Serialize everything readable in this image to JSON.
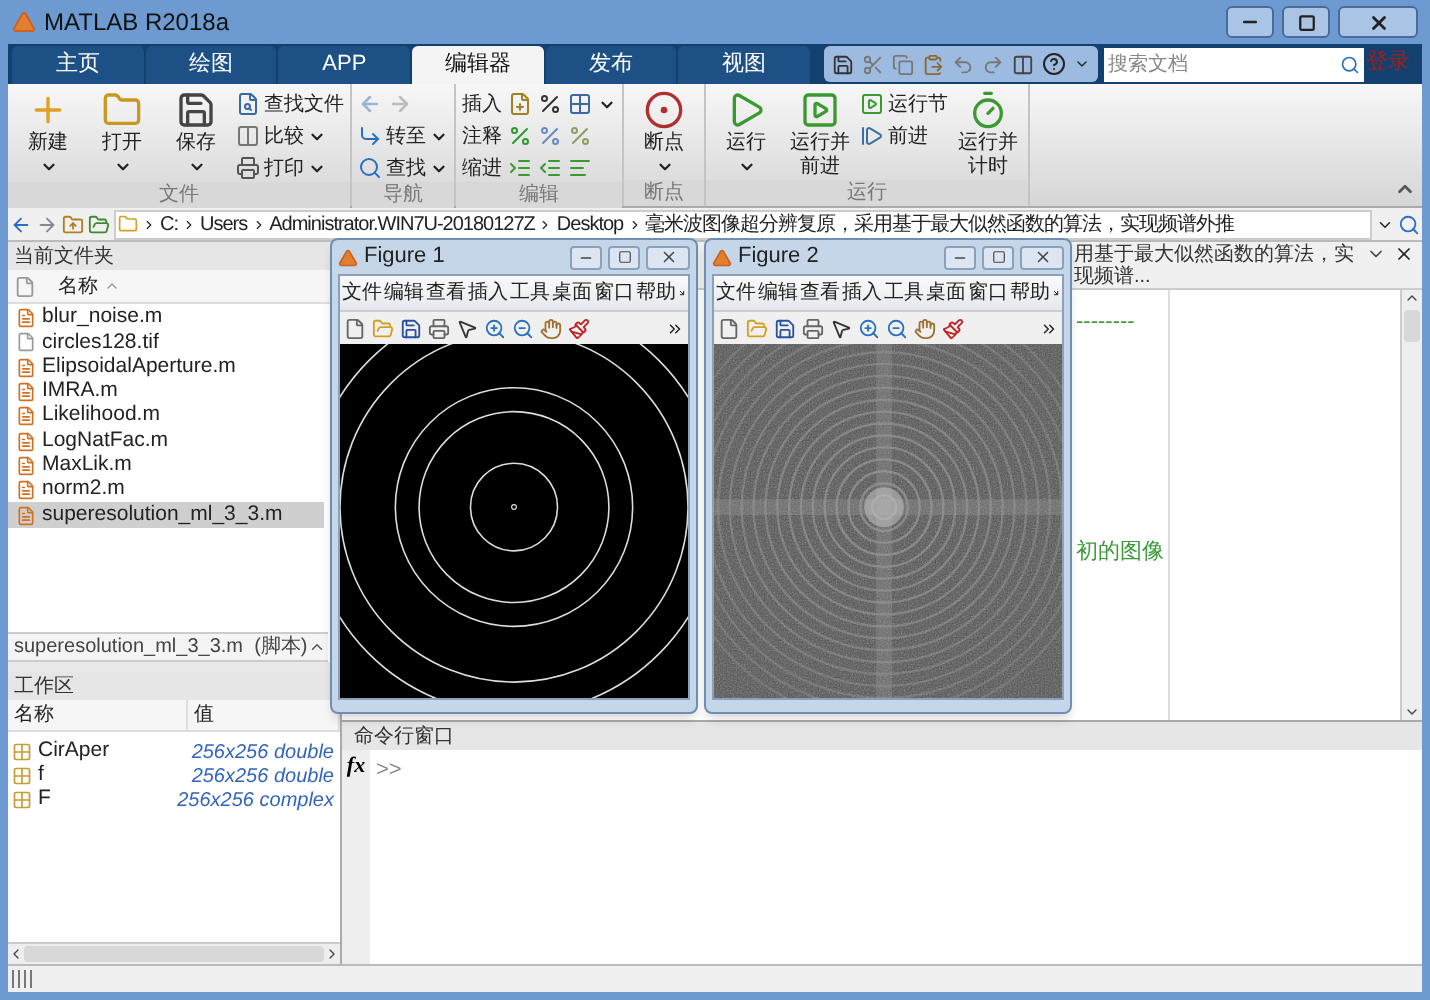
{
  "window": {
    "title": "MATLAB R2018a"
  },
  "tabs": [
    {
      "label": "主页",
      "selected": false
    },
    {
      "label": "绘图",
      "selected": false
    },
    {
      "label": "APP",
      "selected": false
    },
    {
      "label": "编辑器",
      "selected": true
    },
    {
      "label": "发布",
      "selected": false
    },
    {
      "label": "视图",
      "selected": false
    }
  ],
  "search": {
    "placeholder": "搜索文档"
  },
  "login": "登录",
  "ribbon": {
    "groups": [
      {
        "label": "文件",
        "items": [
          {
            "kind": "large",
            "label": "新建",
            "dropdown": true
          },
          {
            "kind": "large",
            "label": "打开",
            "dropdown": true
          },
          {
            "kind": "large",
            "label": "保存",
            "dropdown": true
          },
          {
            "kind": "small",
            "label": "查找文件",
            "dropdown": false
          },
          {
            "kind": "small",
            "label": "比较",
            "dropdown": true
          },
          {
            "kind": "small",
            "label": "打印",
            "dropdown": true
          }
        ]
      },
      {
        "label": "导航",
        "items": [
          {
            "kind": "nav",
            "disabled": true
          },
          {
            "kind": "small",
            "label": "转至",
            "dropdown": true
          },
          {
            "kind": "small",
            "label": "查找",
            "dropdown": true
          }
        ]
      },
      {
        "label": "编辑",
        "items": [
          {
            "kind": "edit",
            "label": "插入",
            "dropdown": true
          },
          {
            "kind": "edit",
            "label": "注释"
          },
          {
            "kind": "edit",
            "label": "缩进"
          }
        ]
      },
      {
        "label": "断点",
        "items": [
          {
            "kind": "large",
            "label": "断点",
            "dropdown": true
          }
        ]
      },
      {
        "label": "运行",
        "items": [
          {
            "kind": "large",
            "label": "运行",
            "dropdown": true
          },
          {
            "kind": "large",
            "label": "运行并前进",
            "dropdown": false
          },
          {
            "kind": "small",
            "label": "运行节",
            "dropdown": false
          },
          {
            "kind": "small",
            "label": "前进",
            "dropdown": false
          },
          {
            "kind": "large",
            "label": "运行并计时",
            "dropdown": false
          }
        ]
      }
    ]
  },
  "address": {
    "path": [
      "C:",
      "Users",
      "Administrator.WIN7U-20180127Z",
      "Desktop",
      "毫米波图像超分辨复原，采用基于最大似然函数的算法，实现频谱外推"
    ]
  },
  "current_folder": {
    "title": "当前文件夹",
    "column": "名称",
    "files": [
      {
        "name": "blur_noise.m",
        "kind": "script",
        "selected": false
      },
      {
        "name": "circles128.tif",
        "kind": "file",
        "selected": false
      },
      {
        "name": "ElipsoidalAperture.m",
        "kind": "script",
        "selected": false
      },
      {
        "name": "IMRA.m",
        "kind": "script",
        "selected": false
      },
      {
        "name": "Likelihood.m",
        "kind": "script",
        "selected": false
      },
      {
        "name": "LogNatFac.m",
        "kind": "script",
        "selected": false
      },
      {
        "name": "MaxLik.m",
        "kind": "script",
        "selected": false
      },
      {
        "name": "norm2.m",
        "kind": "script",
        "selected": false
      },
      {
        "name": "superesolution_ml_3_3.m",
        "kind": "script",
        "selected": true
      }
    ],
    "details": "superesolution_ml_3_3.m  (脚本)"
  },
  "workspace": {
    "title": "工作区",
    "columns": [
      "名称",
      "值"
    ],
    "rows": [
      {
        "name": "CirAper",
        "value": "256x256 double"
      },
      {
        "name": "f",
        "value": "256x256 double"
      },
      {
        "name": "F",
        "value": "256x256 complex"
      }
    ]
  },
  "editor": {
    "tab_title": "用基于最大似然函数的算法，实现频谱...",
    "lines": [
      {
        "text": "--------"
      },
      {
        "text": "初的图像"
      }
    ]
  },
  "command_window": {
    "title": "命令行窗口",
    "function_button": "fx",
    "prompt": ">>"
  },
  "figures": [
    {
      "title": "Figure 1",
      "menu": [
        "文件",
        "编辑",
        "查看",
        "插入",
        "工具",
        "桌面",
        "窗口",
        "帮助"
      ]
    },
    {
      "title": "Figure 2",
      "menu": [
        "文件",
        "编辑",
        "查看",
        "插入",
        "工具",
        "桌面",
        "窗口",
        "帮助"
      ]
    }
  ]
}
